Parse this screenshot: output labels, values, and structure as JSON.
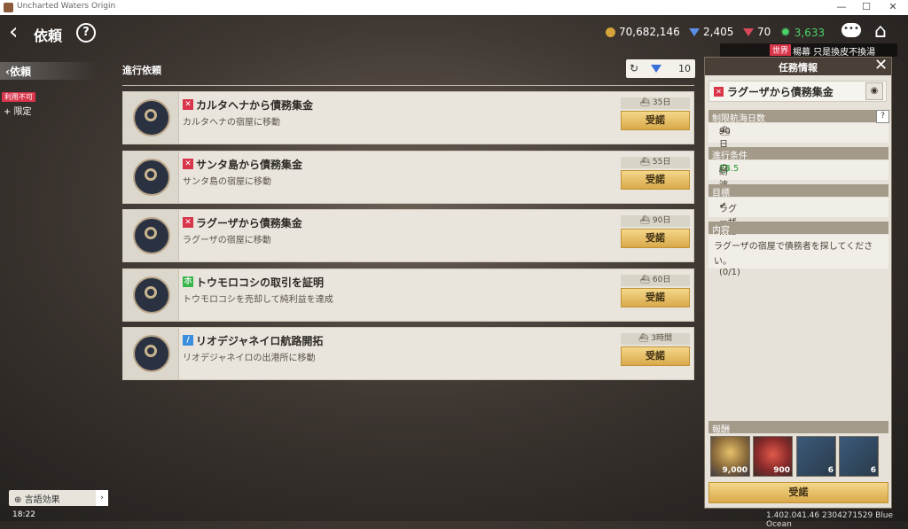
{
  "window": {
    "title": "Uncharted Waters Origin",
    "controls": [
      "—",
      "☐",
      "✕"
    ]
  },
  "header": {
    "back_icon": "‹",
    "title": "依頼",
    "help_icon": "?"
  },
  "resources": {
    "gold": "70,682,146",
    "blue_gems": "2,405",
    "red_gems": "70",
    "green_points": "3,633"
  },
  "world_chat": {
    "tag": "世界",
    "message": "楊幕 只是換皮不換湯"
  },
  "left_panel": {
    "tab_label": "依頼",
    "unavailable_badge": "利用不可",
    "limited_label": "+ 限定",
    "language_button": "言語効果",
    "language_arrow": "›",
    "clock": "18:22"
  },
  "quest_list": {
    "title": "進行依頼",
    "refresh_icon": "↻",
    "refresh_cost": "10",
    "accept_label": "受諾",
    "quests": [
      {
        "icon_text": "✕",
        "icon_color": "#d8344a",
        "title": "カルタヘナから債務集金",
        "subtitle": "カルタヘナの宿屋に移動",
        "duration": "35日"
      },
      {
        "icon_text": "✕",
        "icon_color": "#d8344a",
        "title": "サンタ島から債務集金",
        "subtitle": "サンタ島の宿屋に移動",
        "duration": "55日"
      },
      {
        "icon_text": "✕",
        "icon_color": "#d8344a",
        "title": "ラグーザから債務集金",
        "subtitle": "ラグーザの宿屋に移動",
        "duration": "90日"
      },
      {
        "icon_text": "ホ",
        "icon_color": "#39b54a",
        "title": "トウモロコシの取引を証明",
        "subtitle": "トウモロコシを売却して純利益を達成",
        "duration": "60日"
      },
      {
        "icon_text": "/",
        "icon_color": "#3b8de0",
        "title": "リオデジャネイロ航路開拓",
        "subtitle": "リオデジャネイロの出港所に移動",
        "duration": "3時間"
      }
    ]
  },
  "detail_panel": {
    "header": "任務情報",
    "close_icon": "✕",
    "quest_title": "ラグーザから債務集金",
    "map_icon": "◉",
    "sections": {
      "limit_days_label": "制限航海日数",
      "limit_days_value": "90日",
      "conditions_label": "進行条件",
      "condition_name": "耐波",
      "condition_value": "78.5",
      "condition_target": "/2",
      "objective_label": "目標",
      "objective_value": "ラグーザの宿屋に移動(0/1)",
      "content_label": "内容",
      "content_line1": "ラグーザの宿屋で債務者を探してくださ",
      "content_line2": "い。"
    },
    "rewards_label": "報酬",
    "rewards": [
      {
        "icon": "medal-icon",
        "count": "9,000"
      },
      {
        "icon": "laurel-badge-icon",
        "count": "900"
      },
      {
        "icon": "book-icon",
        "count": "6"
      },
      {
        "icon": "book-icon",
        "count": "6"
      }
    ],
    "accept_label": "受諾"
  },
  "version": "1.402.041.46 2304271529 Blue Ocean"
}
